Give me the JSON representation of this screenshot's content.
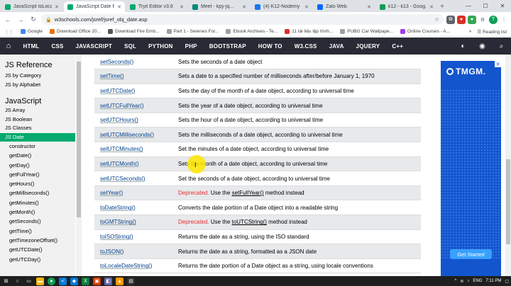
{
  "browser": {
    "tabs": [
      {
        "title": "JavaScript toLoca...",
        "color": "#04aa6d",
        "active": false
      },
      {
        "title": "JavaScript Date R...",
        "color": "#04aa6d",
        "active": true
      },
      {
        "title": "Tryit Editor v3.6",
        "color": "#04aa6d",
        "active": false
      },
      {
        "title": "Meet - kpy-jq...",
        "color": "#00897b",
        "active": false
      },
      {
        "title": "(4) K12-Nodemy",
        "color": "#1877f2",
        "active": false
      },
      {
        "title": "Zalo Web",
        "color": "#0068ff",
        "active": false
      },
      {
        "title": "k12 - k13 - Goog...",
        "color": "#0f9d58",
        "active": false
      }
    ],
    "new_tab": "+",
    "url": "w3schools.com/jsref/jsref_obj_date.asp",
    "bookmarks": [
      {
        "label": "Google",
        "color": "#4285f4"
      },
      {
        "label": "Download Office 20...",
        "color": "#e8710a"
      },
      {
        "label": "Download Fire Emb...",
        "color": "#555555"
      },
      {
        "label": "Part 1 - Serenes For...",
        "color": "#9aa0a6"
      },
      {
        "label": "Ebook Archives - Te...",
        "color": "#9aa0a6"
      },
      {
        "label": "11 tài liệu lập trình...",
        "color": "#d93025"
      },
      {
        "label": "PUBG Car Wallpape...",
        "color": "#9aa0a6"
      },
      {
        "label": "Online Courses - A...",
        "color": "#a435f0"
      }
    ],
    "reading_list": "Reading list"
  },
  "w3nav": {
    "items": [
      "HTML",
      "CSS",
      "JAVASCRIPT",
      "SQL",
      "PYTHON",
      "PHP",
      "BOOTSTRAP",
      "HOW TO",
      "W3.CSS",
      "JAVA",
      "JQUERY",
      "C++"
    ]
  },
  "sidebar": {
    "title": "JS Reference",
    "links": [
      "JS by Category",
      "JS by Alphabet"
    ],
    "section": "JavaScript",
    "js_items": [
      "JS Array",
      "JS Boolean",
      "JS Classes",
      "JS Date"
    ],
    "selected": "JS Date",
    "methods": [
      "constructor",
      "getDate()",
      "getDay()",
      "getFullYear()",
      "getHours()",
      "getMilliseconds()",
      "getMinutes()",
      "getMonth()",
      "getSeconds()",
      "getTime()",
      "getTimezoneOffset()",
      "getUTCDate()",
      "getUTCDay()"
    ]
  },
  "table": {
    "rows": [
      {
        "method": "setSeconds()",
        "desc": "Sets the seconds of a date object"
      },
      {
        "method": "setTime()",
        "desc": "Sets a date to a specified number of milliseconds after/before January 1, 1970"
      },
      {
        "method": "setUTCDate()",
        "desc": "Sets the day of the month of a date object, according to universal time"
      },
      {
        "method": "setUTCFullYear()",
        "desc": "Sets the year of a date object, according to universal time"
      },
      {
        "method": "setUTCHours()",
        "desc": "Sets the hour of a date object, according to universal time"
      },
      {
        "method": "setUTCMilliseconds()",
        "desc": "Sets the milliseconds of a date object, according to universal time"
      },
      {
        "method": "setUTCMinutes()",
        "desc": "Set the minutes of a date object, according to universal time"
      },
      {
        "method": "setUTCMonth()",
        "desc": "Sets the month of a date object, according to universal time"
      },
      {
        "method": "setUTCSeconds()",
        "desc": "Set the seconds of a date object, according to universal time"
      },
      {
        "method": "setYear()",
        "dep": "Deprecated.",
        "pre": " Use the ",
        "link": "setFullYear()",
        "post": " method instead"
      },
      {
        "method": "toDateString()",
        "desc": "Converts the date portion of a Date object into a readable string"
      },
      {
        "method": "toGMTString()",
        "dep": "Deprecated.",
        "pre": " Use the ",
        "link": "toUTCString()",
        "post": " method instead"
      },
      {
        "method": "toISOString()",
        "desc": "Returns the date as a string, using the ISO standard"
      },
      {
        "method": "toJSON()",
        "desc": "Returns the date as a string, formatted as a JSON date"
      },
      {
        "method": "toLocaleDateString()",
        "desc": "Returns the date portion of a Date object as a string, using locale conventions"
      }
    ]
  },
  "ad": {
    "brand": "TMGM.",
    "cta": "Get Started"
  },
  "taskbar": {
    "lang": "ENG",
    "time": "7:11 PM"
  }
}
